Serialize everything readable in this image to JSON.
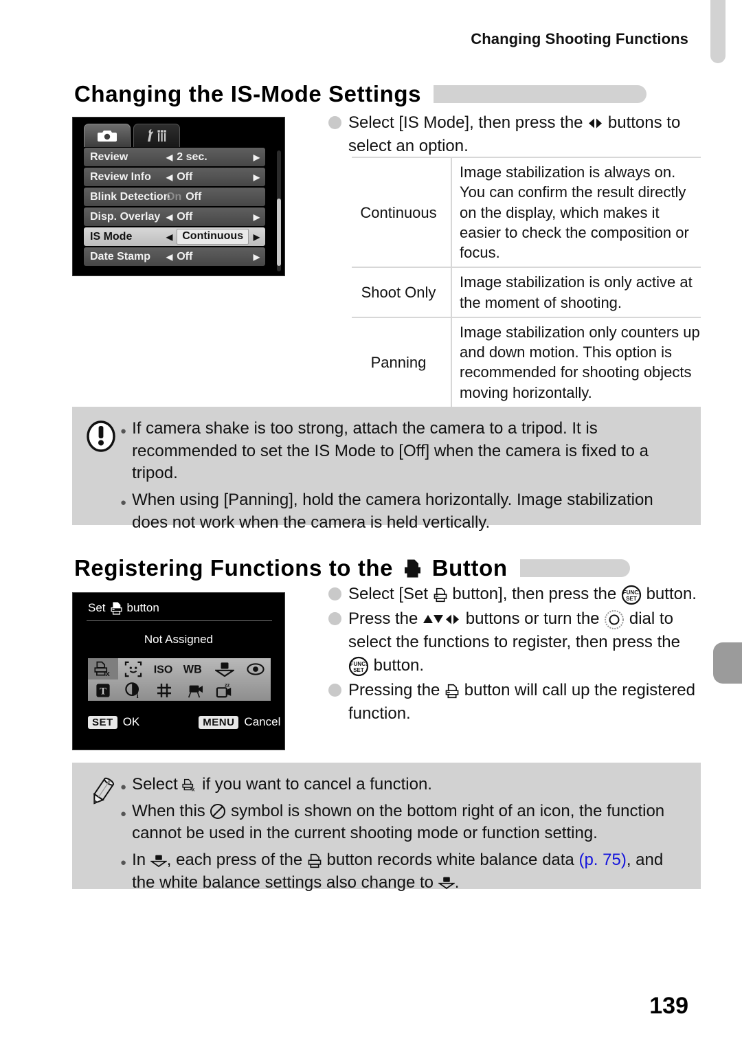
{
  "running_header": "Changing Shooting Functions",
  "page_number": "139",
  "section_is": {
    "heading": "Changing the IS-Mode Settings",
    "step": "Select [IS Mode], then press the ◀▶ buttons to select an option.",
    "step_part1": "Select [IS Mode], then press the",
    "step_part2": "buttons to select an option.",
    "menu": {
      "tabs": [
        "camera-tab",
        "tools-tab"
      ],
      "rows": [
        {
          "label": "Review",
          "value": "2 sec.",
          "left_caret": true,
          "right_caret": true,
          "selected": false,
          "toggle": false
        },
        {
          "label": "Review Info",
          "value": "Off",
          "left_caret": true,
          "right_caret": true,
          "selected": false,
          "toggle": false
        },
        {
          "label": "Blink Detection",
          "value_on": "On",
          "value_off": "Off",
          "left_caret": false,
          "right_caret": false,
          "selected": false,
          "toggle": true
        },
        {
          "label": "Disp. Overlay",
          "value": "Off",
          "left_caret": true,
          "right_caret": true,
          "selected": false,
          "toggle": false
        },
        {
          "label": "IS Mode",
          "value": "Continuous",
          "left_caret": true,
          "right_caret": true,
          "selected": true,
          "toggle": false
        },
        {
          "label": "Date Stamp",
          "value": "Off",
          "left_caret": true,
          "right_caret": true,
          "selected": false,
          "toggle": false
        }
      ]
    },
    "table": {
      "rows": [
        {
          "name": "Continuous",
          "desc": "Image stabilization is always on. You can confirm the result directly on the display, which makes it easier to check the composition or focus."
        },
        {
          "name": "Shoot Only",
          "desc": "Image stabilization is only active at the moment of shooting."
        },
        {
          "name": "Panning",
          "desc": "Image stabilization only counters up and down motion. This option is recommended for shooting objects moving horizontally."
        }
      ]
    },
    "warning_notes": [
      "If camera shake is too strong, attach the camera to a tripod. It is recommended to set the IS Mode to [Off] when the camera is fixed to a tripod.",
      "When using [Panning], hold the camera horizontally. Image stabilization does not work when the camera is held vertically."
    ]
  },
  "section_register": {
    "heading_part1": "Registering Functions to the",
    "heading_part2": "Button",
    "screen": {
      "title_part1": "Set",
      "title_part2": "button",
      "assigned_value": "Not Assigned",
      "icons": [
        {
          "name": "print-cancel-icon",
          "selected": true
        },
        {
          "name": "face-select-icon",
          "selected": false
        },
        {
          "name": "iso-icon",
          "selected": false
        },
        {
          "name": "white-balance-icon",
          "selected": false
        },
        {
          "name": "custom-wb-icon",
          "selected": false
        },
        {
          "name": "red-eye-icon",
          "selected": false
        },
        {
          "name": "text-display-icon",
          "selected": false
        },
        {
          "name": "i-contrast-icon",
          "selected": false
        },
        {
          "name": "grid-lines-icon",
          "selected": false
        },
        {
          "name": "movie-record-icon",
          "selected": false
        },
        {
          "name": "display-off-icon",
          "selected": false
        }
      ],
      "footer_set_key": "SET",
      "footer_set_label": "OK",
      "footer_menu_key": "MENU",
      "footer_menu_label": "Cancel"
    },
    "steps": [
      {
        "part1": "Select [Set",
        "icon1": "print-icon",
        "part2": "button], then press the",
        "icon2": "func-set-icon",
        "part3": "button."
      },
      {
        "part1": "Press the",
        "icon1": "updown-leftright-icon",
        "part2": "buttons or turn the",
        "icon2": "control-dial-icon",
        "part3": "dial to select the functions to register, then press the",
        "icon3": "func-set-icon",
        "part4": "button."
      },
      {
        "part1": "Pressing the",
        "icon1": "print-icon",
        "part2": "button will call up the registered function."
      }
    ],
    "info_notes": [
      {
        "part1": "Select",
        "icon": "print-cancel-icon",
        "part2": "if you want to cancel a function."
      },
      {
        "part1": "When this",
        "icon": "prohibited-icon",
        "part2": "symbol is shown on the bottom right of an icon, the function cannot be used in the current shooting mode or function setting."
      },
      {
        "part1": "In",
        "icon1": "custom-wb-icon",
        "part2": ", each press of the",
        "icon2": "print-icon",
        "part3": "button records white balance data",
        "link": "(p. 75)",
        "part4": ", and the white balance settings also change to",
        "icon3": "custom-wb-icon",
        "part5": "."
      }
    ]
  },
  "colors": {
    "note_box": "#d2d2d2",
    "heading_bar": "#d2d2d2",
    "link": "#1414dc",
    "lcd_background": "#000000",
    "menu_row": "#565656",
    "menu_row_selected": "#cccccc",
    "edge_tab": "#9b9b9b"
  }
}
